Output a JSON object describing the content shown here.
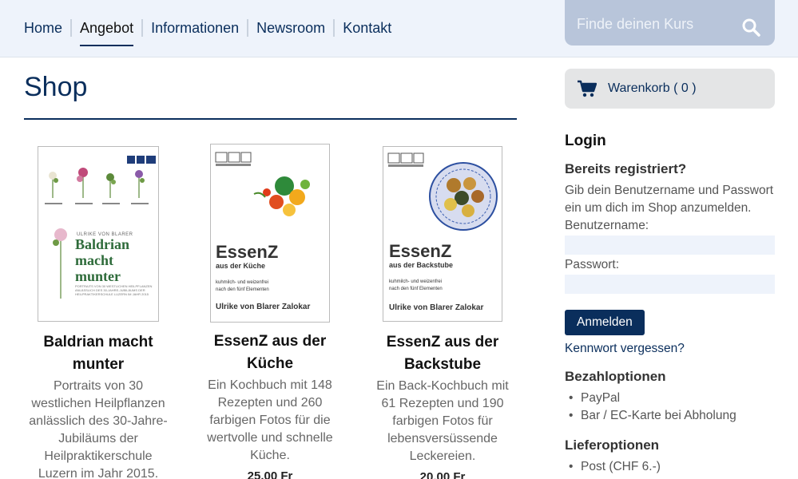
{
  "nav": {
    "items": [
      {
        "label": "Home",
        "active": false
      },
      {
        "label": "Angebot",
        "active": true
      },
      {
        "label": "Informationen",
        "active": false
      },
      {
        "label": "Newsroom",
        "active": false
      },
      {
        "label": "Kontakt",
        "active": false
      }
    ]
  },
  "search": {
    "placeholder": "Finde deinen Kurs",
    "icon": "search-icon"
  },
  "page": {
    "title": "Shop"
  },
  "products": [
    {
      "name": "Baldrian macht munter",
      "description": "Portraits von 30 westlichen Heilpflanzen anlässlich des 30-Jahre-Jubiläums der Heilpraktikerschule Luzern im Jahr 2015.",
      "cover": {
        "author": "ULRIKE VON BLARER",
        "title_lines": [
          "Baldrian",
          "macht",
          "munter"
        ],
        "small": "PORTRAITS VON 30 WESTLICHEN HEILPFLANZEN ANLÄSSLICH DES 30-JAHRE-JUBILÄUMS DER HEILPRAKTIKERSCHULE LUZERN IM JAHR 2015"
      }
    },
    {
      "name": "EssenZ aus der Küche",
      "description": "Ein Kochbuch mit 148 Rezepten und 260 farbigen Fotos für die wertvolle und schnelle Küche.",
      "price": "25.00 Fr",
      "cover": {
        "title": "EssenZ",
        "subtitle": "aus der Küche",
        "tagline_1": "kuhmilch- und weizenfrei",
        "tagline_2": "nach den fünf Elementen",
        "author": "Ulrike von Blarer Zalokar"
      }
    },
    {
      "name": "EssenZ aus der Backstube",
      "description": "Ein Back-Kochbuch mit 61 Rezepten und 190 farbigen Fotos für lebensversüssende Leckereien.",
      "price": "20.00 Fr",
      "cover": {
        "title": "EssenZ",
        "subtitle": "aus der Backstube",
        "tagline_1": "kuhmilch- und weizenfrei",
        "tagline_2": "nach den fünf Elementen",
        "author": "Ulrike von Blarer Zalokar"
      }
    }
  ],
  "cart": {
    "label": "Warenkorb ( 0 )",
    "icon": "cart-icon"
  },
  "login": {
    "heading": "Login",
    "registered_heading": "Bereits registriert?",
    "intro": "Gib dein Benutzername und Passwort ein um dich im Shop anzumelden.",
    "username_label": "Benutzername:",
    "username_value": "",
    "password_label": "Passwort:",
    "password_value": "",
    "submit_label": "Anmelden",
    "forgot_label": "Kennwort vergessen?"
  },
  "payment": {
    "heading": "Bezahloptionen",
    "items": [
      "PayPal",
      "Bar / EC-Karte bei Abholung"
    ]
  },
  "delivery": {
    "heading": "Lieferoptionen",
    "items": [
      "Post (CHF 6.-)"
    ]
  },
  "colors": {
    "primary": "#0a2e5c",
    "topbar": "#eef3fb",
    "search_bg": "#b8c5da",
    "cart_bg": "#e4e5e6"
  }
}
